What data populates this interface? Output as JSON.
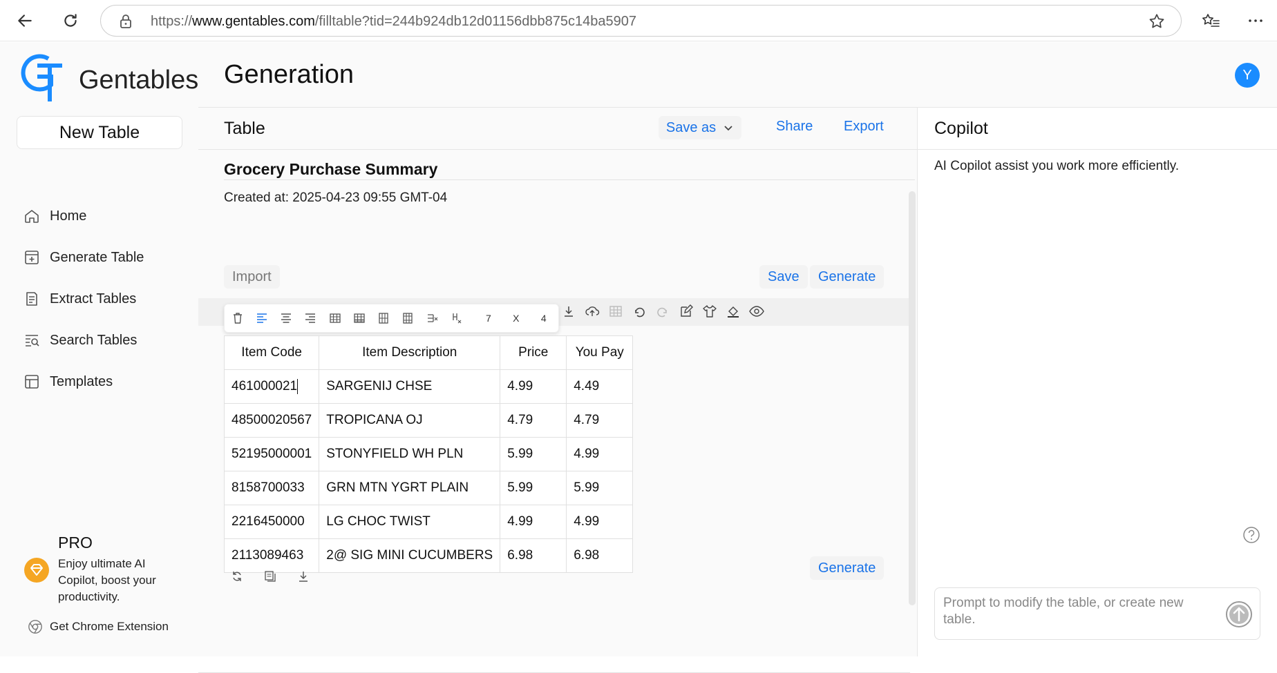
{
  "browser": {
    "url_prefix": "https://",
    "url_domain": "www.gentables.com",
    "url_path": "/filltable?tid=244b924db12d01156dbb875c14ba5907"
  },
  "sidebar": {
    "logo_text": "Gentables",
    "new_table_label": "New Table",
    "items": [
      {
        "label": "Home",
        "icon": "home-icon"
      },
      {
        "label": "Generate Table",
        "icon": "plus-square-icon"
      },
      {
        "label": "Extract Tables",
        "icon": "document-list-icon"
      },
      {
        "label": "Search Tables",
        "icon": "search-list-icon"
      },
      {
        "label": "Templates",
        "icon": "template-icon"
      }
    ],
    "pro": {
      "title": "PRO",
      "description": "Enjoy ultimate AI Copilot, boost your productivity."
    },
    "chrome_extension_label": "Get Chrome Extension"
  },
  "header": {
    "title": "Generation",
    "avatar_letter": "Y"
  },
  "table_panel": {
    "title": "Table",
    "save_as_label": "Save as",
    "share_label": "Share",
    "export_label": "Export",
    "doc_title": "Grocery Purchase Summary",
    "created_at": "Created at: 2025-04-23 09:55 GMT-04",
    "import_label": "Import",
    "save_label": "Save",
    "generate_label": "Generate",
    "rows_value": "7",
    "cols_value": "4",
    "times_sign": "X",
    "bottom_generate_label": "Generate",
    "columns": [
      "Item Code",
      "Item Description",
      "Price",
      "You Pay"
    ],
    "rows": [
      [
        "461000021",
        "SARGENIJ CHSE",
        "4.99",
        "4.49"
      ],
      [
        "48500020567",
        "TROPICANA OJ",
        "4.79",
        "4.79"
      ],
      [
        "52195000001",
        "STONYFIELD WH PLN",
        "5.99",
        "4.99"
      ],
      [
        "8158700033",
        "GRN MTN YGRT PLAIN",
        "5.99",
        "5.99"
      ],
      [
        "2216450000",
        "LG CHOC TWIST",
        "4.99",
        "4.99"
      ],
      [
        "2113089463",
        "2@ SIG MINI CUCUMBERS",
        "6.98",
        "6.98"
      ]
    ]
  },
  "copilot": {
    "title": "Copilot",
    "description": "AI Copilot assist you work more efficiently.",
    "prompt_placeholder": "Prompt to modify the table, or create new table."
  },
  "colors": {
    "accent": "#1a73e8",
    "avatar_bg": "#1a8cff",
    "pro_badge": "#f5a623"
  }
}
